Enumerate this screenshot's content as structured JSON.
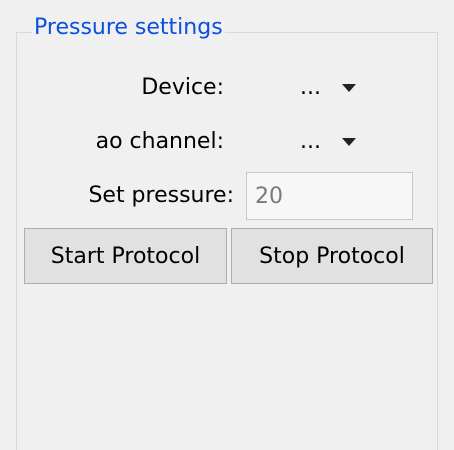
{
  "group": {
    "title": "Pressure settings"
  },
  "device": {
    "label": "Device:",
    "value": "..."
  },
  "ao_channel": {
    "label": "ao channel:",
    "value": "..."
  },
  "pressure": {
    "label": "Set pressure:",
    "value": "20"
  },
  "buttons": {
    "start": "Start Protocol",
    "stop": "Stop Protocol"
  },
  "colors": {
    "title": "#0a4fe0",
    "background": "#f0f0f0",
    "button": "#e1e1e1"
  },
  "icons": {
    "dropdown": "chevron-down-icon"
  }
}
